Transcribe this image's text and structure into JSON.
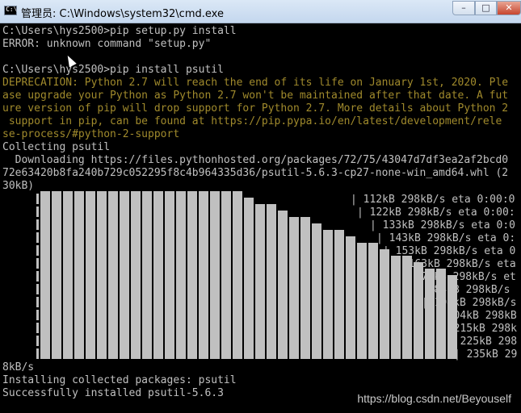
{
  "window": {
    "title": "管理员: C:\\Windows\\system32\\cmd.exe",
    "icon": "cmd-icon",
    "controls": {
      "minimize": "–",
      "maximize": "□",
      "close": "✕"
    }
  },
  "console": {
    "lines": [
      "C:\\Users\\hys2500>pip setup.py install",
      "ERROR: unknown command \"setup.py\"",
      "",
      "C:\\Users\\hys2500>pip install psutil",
      "DEPRECATION: Python 2.7 will reach the end of its life on January 1st, 2020. Ple",
      "ase upgrade your Python as Python 2.7 won't be maintained after that date. A fut",
      "ure version of pip will drop support for Python 2.7. More details about Python 2",
      " support in pip, can be found at https://pip.pypa.io/en/latest/development/rele",
      "se-process/#python-2-support",
      "Collecting psutil",
      "  Downloading https://files.pythonhosted.org/packages/72/75/43047d7df3ea2af2bcd0",
      "72e63420b8fa240b729c052295f8c4b964335d36/psutil-5.6.3-cp27-none-win_amd64.whl (2",
      "30kB)"
    ],
    "progress_lines": [
      "| 112kB 298kB/s eta 0:00:0",
      "| 122kB 298kB/s eta 0:00:",
      "| 133kB 298kB/s eta 0:0",
      "| 143kB 298kB/s eta 0:",
      "| 153kB 298kB/s eta 0",
      "| 163kB 298kB/s eta",
      "| 174kB 298kB/s et",
      "| 184kB 298kB/s",
      "| 194kB 298kB/s",
      "| 204kB 298kB",
      "| 215kB 298k",
      "| 225kB 298",
      "| 235kB 29"
    ],
    "tail_lines": [
      "8kB/s",
      "Installing collected packages: psutil",
      "Successfully installed psutil-5.6.3"
    ]
  },
  "watermark": "https://blog.csdn.net/Beyouself",
  "colors": {
    "console_bg": "#000000",
    "console_fg": "#c0c0c0",
    "warning_fg": "#a08a2c"
  }
}
